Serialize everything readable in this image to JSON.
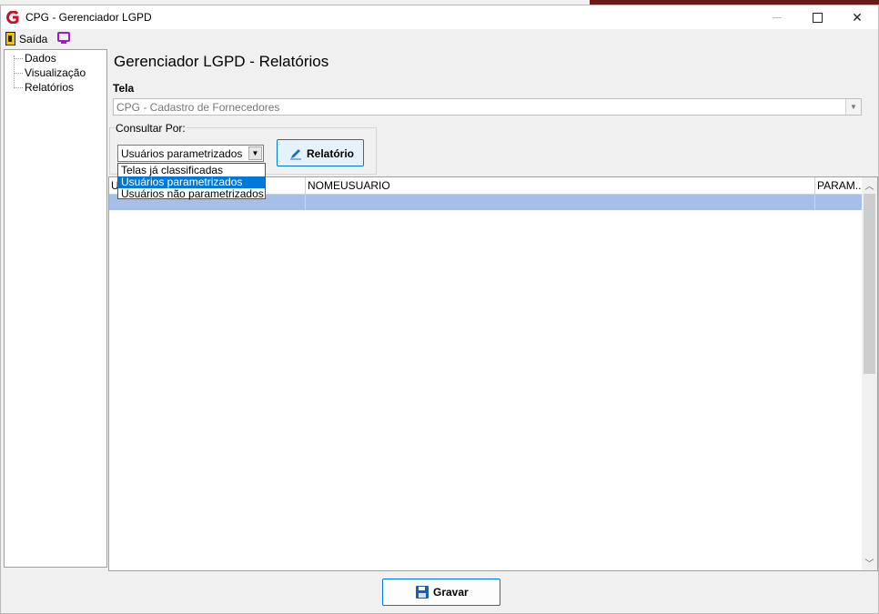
{
  "window": {
    "title": "CPG - Gerenciador LGPD"
  },
  "menubar": {
    "exit_label": "Saída"
  },
  "sidebar": {
    "items": [
      {
        "label": "Dados"
      },
      {
        "label": "Visualização"
      },
      {
        "label": "Relatórios"
      }
    ]
  },
  "page": {
    "title": "Gerenciador LGPD - Relatórios"
  },
  "tela": {
    "label": "Tela",
    "value": "CPG - Cadastro de Fornecedores"
  },
  "consultar": {
    "label": "Consultar Por:",
    "selected": "Usuários parametrizados",
    "options": [
      "Telas já classificadas",
      "Usuários parametrizados",
      "Usuários não parametrizados"
    ],
    "button_label": "Relatório"
  },
  "grid": {
    "columns": [
      "U",
      "NOMEUSUARIO",
      "PARAM..."
    ]
  },
  "footer": {
    "save_label": "Gravar"
  },
  "colors": {
    "accent": "#0078d7",
    "row_highlight": "#a6bfe8",
    "logo_red": "#c8102e",
    "monitor_purple": "#9a1fc9"
  }
}
